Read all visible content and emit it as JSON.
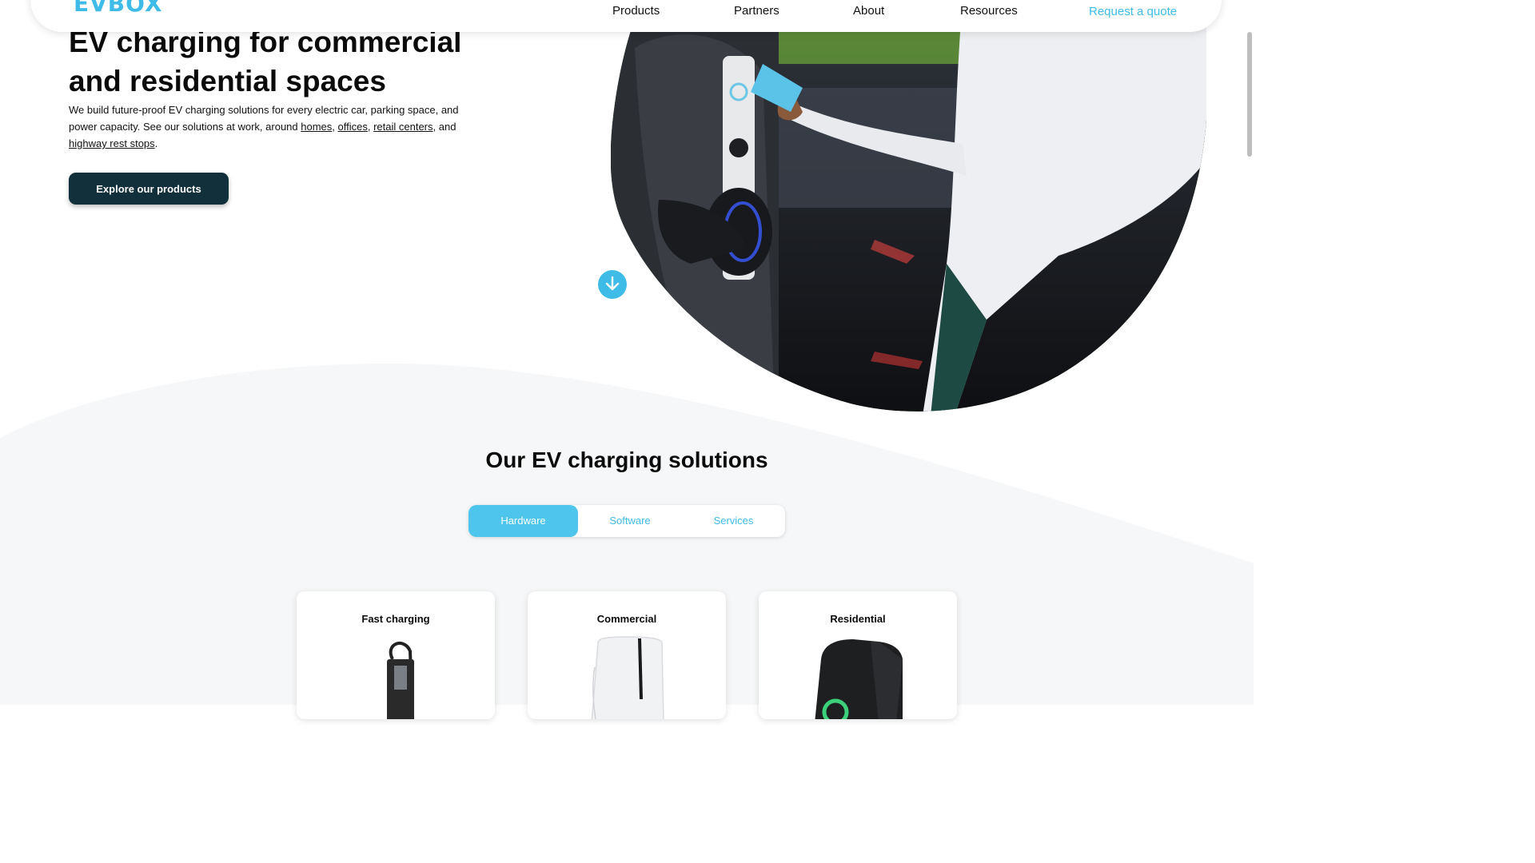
{
  "brand": {
    "logo_text": "EVBOX",
    "accent": "#3fbbe8",
    "dark": "#12303c"
  },
  "nav": {
    "products": "Products",
    "partners": "Partners",
    "about": "About",
    "resources": "Resources",
    "request_quote": "Request a quote"
  },
  "hero": {
    "title": "EV charging for commercial and residential spaces",
    "desc_intro": "We build future-proof EV charging solutions for every electric car, parking space, and power capacity. See our solutions at work, around ",
    "link_homes": "homes",
    "sep1": ", ",
    "link_offices": "offices",
    "sep2": ", ",
    "link_retail": "retail centers",
    "sep3": ", and ",
    "link_highway": "highway rest stops",
    "desc_end": ".",
    "cta": "Explore our products",
    "scroll_icon": "arrow-down-circle-icon"
  },
  "solutions": {
    "title": "Our EV charging solutions",
    "tabs": [
      {
        "label": "Hardware",
        "active": true
      },
      {
        "label": "Software",
        "active": false
      },
      {
        "label": "Services",
        "active": false
      }
    ],
    "cards": [
      {
        "title": "Fast charging"
      },
      {
        "title": "Commercial"
      },
      {
        "title": "Residential"
      }
    ]
  }
}
